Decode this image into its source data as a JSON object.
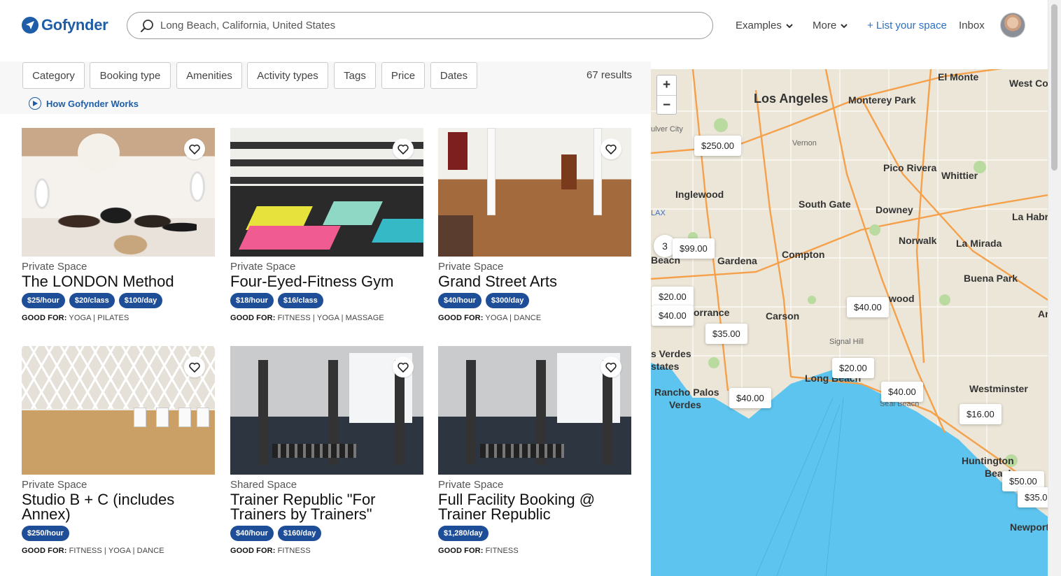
{
  "header": {
    "brand": "Gofynder",
    "search_value": "Long Beach, California, United States",
    "nav": {
      "examples": "Examples",
      "more": "More",
      "list_space": "+ List your space",
      "inbox": "Inbox"
    }
  },
  "filters": {
    "chips": [
      "Category",
      "Booking type",
      "Amenities",
      "Activity types",
      "Tags",
      "Price",
      "Dates"
    ],
    "results": "67 results",
    "how_it_works": "How Gofynder Works"
  },
  "good_for_label": "GOOD FOR:",
  "listings": [
    {
      "type": "Private Space",
      "title": "The LONDON Method",
      "prices": [
        "$25/hour",
        "$20/class",
        "$100/day"
      ],
      "good_for": "YOGA | PILATES"
    },
    {
      "type": "Private Space",
      "title": "Four-Eyed-Fitness Gym",
      "prices": [
        "$18/hour",
        "$16/class"
      ],
      "good_for": "FITNESS | YOGA | MASSAGE"
    },
    {
      "type": "Private Space",
      "title": "Grand Street Arts",
      "prices": [
        "$40/hour",
        "$300/day"
      ],
      "good_for": "YOGA | DANCE"
    },
    {
      "type": "Private Space",
      "title": "Studio B + C (includes Annex)",
      "prices": [
        "$250/hour"
      ],
      "good_for": "FITNESS | YOGA | DANCE"
    },
    {
      "type": "Shared Space",
      "title": "Trainer Republic \"For Trainers by Trainers\"",
      "prices": [
        "$40/hour",
        "$160/day"
      ],
      "good_for": "FITNESS"
    },
    {
      "type": "Private Space",
      "title": "Full Facility Booking @ Trainer Republic",
      "prices": [
        "$1,280/day"
      ],
      "good_for": "FITNESS"
    }
  ],
  "map": {
    "zoom_in": "+",
    "zoom_out": "−",
    "cluster_count": "3",
    "places": [
      "El Monte",
      "West Covi",
      "Los Angeles",
      "Monterey Park",
      "ulver City",
      "Vernon",
      "Pico Rivera",
      "Whittier",
      "Inglewood",
      "South Gate",
      "Downey",
      "La Habr",
      "Norwalk",
      "La Mirada",
      "Beach",
      "Gardena",
      "Compton",
      "Buena Park",
      "orrance",
      "Carson",
      "wood",
      "Signal Hill",
      "s Verdes",
      "states",
      "Long Beach",
      "Westminster",
      "Rancho Palos",
      "Verdes",
      "Seal Beach",
      "Huntington",
      "Beach",
      "Newport",
      "LAX",
      "Ar"
    ],
    "pins": [
      "$250.00",
      "$99.00",
      "$20.00",
      "$40.00",
      "$40.00",
      "$35.00",
      "$20.00",
      "$40.00",
      "$40.00",
      "$16.00",
      "$50.00",
      "$35.0"
    ]
  },
  "colors": {
    "brand": "#1e5ea8",
    "price_pill": "#1f4e98",
    "link": "#2a6fc4",
    "water": "#5cc4ee"
  }
}
